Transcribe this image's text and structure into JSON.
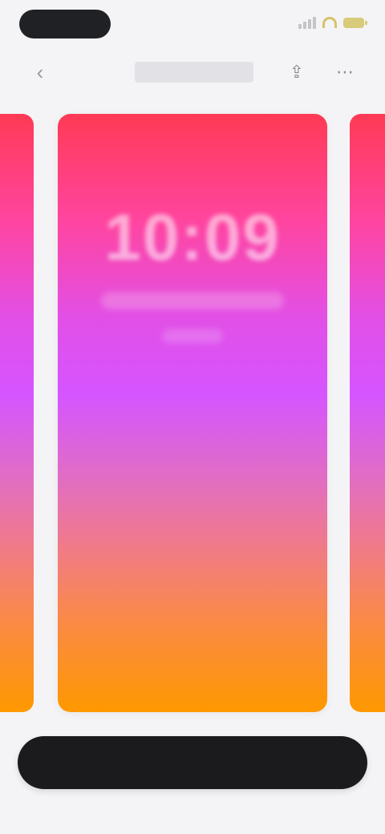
{
  "status_bar": {
    "time": "",
    "icons": [
      "signal-icon",
      "wifi-icon",
      "battery-icon"
    ]
  },
  "nav": {
    "back_icon": "chevron-left-icon",
    "title": "",
    "actions": [
      "share-icon",
      "more-icon"
    ]
  },
  "preview": {
    "time": "10:09",
    "gradient_colors": [
      "#ff3a55",
      "#d555ff",
      "#ff9800"
    ]
  },
  "apply_button": {
    "label": ""
  },
  "colors": {
    "background": "#f4f4f6",
    "button": "#1b1b1d"
  }
}
